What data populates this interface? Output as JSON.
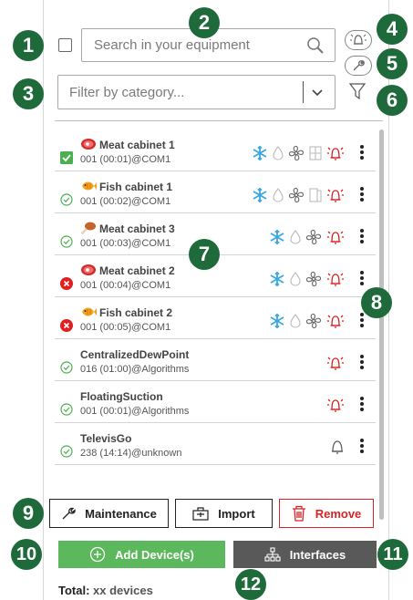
{
  "search": {
    "placeholder": "Search in your equipment"
  },
  "filter": {
    "placeholder": "Filter by category..."
  },
  "callouts": [
    "1",
    "2",
    "3",
    "4",
    "5",
    "6",
    "7",
    "8",
    "9",
    "10",
    "11",
    "12"
  ],
  "devices": [
    {
      "name": "Meat cabinet 1",
      "address": "001 (00:01)@COM1",
      "status": "selected",
      "type": "meat-icon",
      "icons": [
        "snowflake-icon",
        "defrost-icon",
        "fan-icon",
        "rack-icon",
        "alarm-icon"
      ]
    },
    {
      "name": "Fish cabinet 1",
      "address": "001 (00:02)@COM1",
      "status": "ok",
      "type": "fish-icon",
      "icons": [
        "snowflake-icon",
        "defrost-icon",
        "fan-icon",
        "door-icon",
        "alarm-icon"
      ]
    },
    {
      "name": "Meat cabinet 3",
      "address": "001 (00:03)@COM1",
      "status": "ok",
      "type": "poultry-icon",
      "icons": [
        "snowflake-icon",
        "defrost-icon",
        "fan-icon",
        "alarm-icon"
      ]
    },
    {
      "name": "Meat cabinet 2",
      "address": "001 (00:04)@COM1",
      "status": "error",
      "type": "meat-icon",
      "icons": [
        "snowflake-icon",
        "defrost-icon",
        "fan-icon",
        "alarm-icon"
      ]
    },
    {
      "name": "Fish cabinet 2",
      "address": "001 (00:05)@COM1",
      "status": "error",
      "type": "fish-icon",
      "icons": [
        "snowflake-icon",
        "defrost-icon",
        "fan-icon",
        "alarm-icon"
      ]
    },
    {
      "name": "CentralizedDewPoint",
      "address": "016 (01:00)@Algorithms",
      "status": "ok",
      "type": "",
      "icons": [
        "alarm-icon"
      ]
    },
    {
      "name": "FloatingSuction",
      "address": "001 (00:01)@Algorithms",
      "status": "ok",
      "type": "",
      "icons": [
        "alarm-icon"
      ]
    },
    {
      "name": "TelevisGo",
      "address": "238 (14:14)@unknown",
      "status": "ok",
      "type": "",
      "icons": [
        "bell-icon"
      ]
    }
  ],
  "buttons": {
    "maintenance": "Maintenance",
    "import": "Import",
    "remove": "Remove",
    "add": "Add Device(s)",
    "interfaces": "Interfaces"
  },
  "total": {
    "label": "Total:",
    "count": "xx devices"
  },
  "colors": {
    "callout": "#1f6a3a",
    "add": "#5cb85c",
    "interfaces": "#595959",
    "remove": "#dd2222",
    "snowflake": "#3aa7e0",
    "alarm": "#d92020",
    "ok": "#4caf50",
    "error": "#e02020"
  }
}
